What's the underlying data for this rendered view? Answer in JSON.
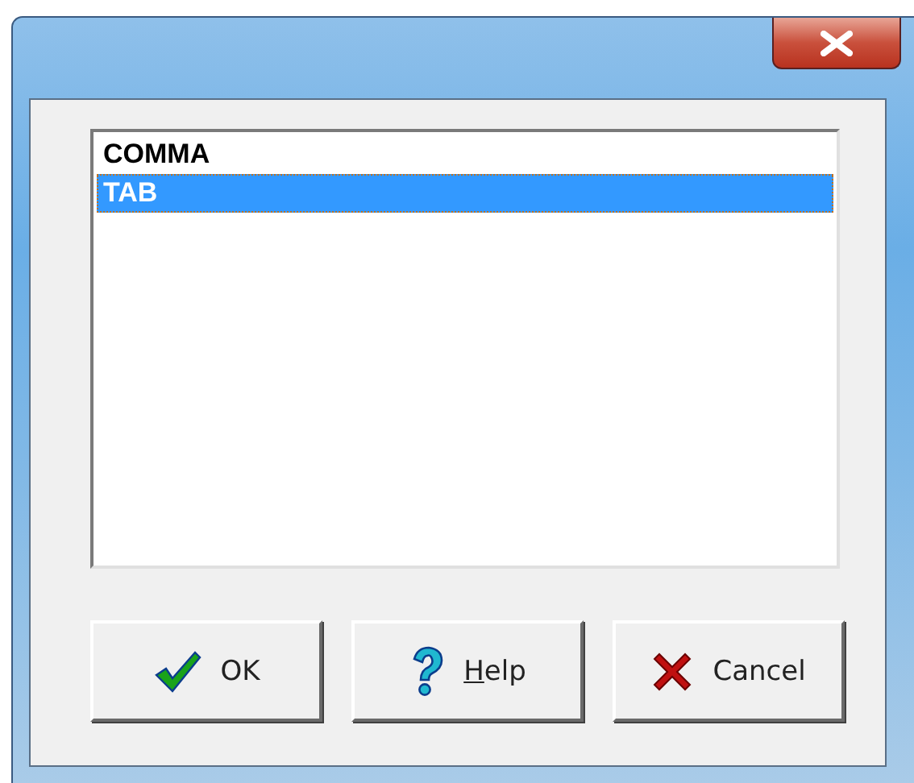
{
  "list": {
    "items": [
      {
        "label": "COMMA",
        "selected": false
      },
      {
        "label": "TAB",
        "selected": true
      }
    ]
  },
  "buttons": [
    {
      "kind": "ok",
      "label": "OK",
      "mnemonic_first": false
    },
    {
      "kind": "help",
      "label": "Help",
      "mnemonic_first": true
    },
    {
      "kind": "cancel",
      "label": "Cancel",
      "mnemonic_first": false
    }
  ]
}
